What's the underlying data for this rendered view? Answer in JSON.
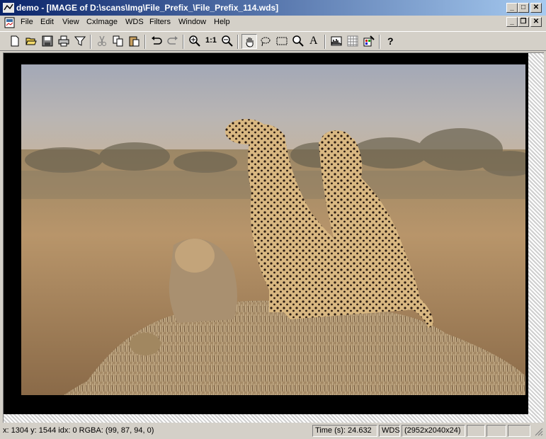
{
  "window": {
    "title": "demo - [IMAGE of D:\\scans\\Img\\File_Prefix_\\File_Prefix_114.wds]",
    "minimize": "_",
    "maximize": "□",
    "close": "✕",
    "mdi_minimize": "_",
    "mdi_restore": "❐",
    "mdi_close": "✕"
  },
  "menu": {
    "items": [
      {
        "label": "File"
      },
      {
        "label": "Edit"
      },
      {
        "label": "View"
      },
      {
        "label": "CxImage"
      },
      {
        "label": "WDS"
      },
      {
        "label": "Filters"
      },
      {
        "label": "Window"
      },
      {
        "label": "Help"
      }
    ]
  },
  "toolbar": {
    "buttons": [
      "new-icon",
      "open-icon",
      "save-icon",
      "print-icon",
      "filter-icon",
      "cut-icon",
      "copy-icon",
      "paste-icon",
      "undo-icon",
      "redo-icon",
      "zoom-in-icon",
      "actual-size-icon",
      "zoom-out-icon",
      "hand-icon",
      "lasso-icon",
      "rect-select-icon",
      "magnifier-icon",
      "text-icon",
      "histogram-icon",
      "grid-icon",
      "palette-icon",
      "help-icon"
    ],
    "actual_size_label": "1:1",
    "text_label": "A",
    "help_label": "?"
  },
  "status": {
    "coords": "x: 1304 y: 1544  idx: 0  RGBA: (99, 87, 94, 0)",
    "time": "Time (s): 24.632",
    "format": "WDS",
    "dimensions": "(2952x2040x24)"
  },
  "colors": {
    "titlebar_start": "#0a246a",
    "titlebar_end": "#a6caf0",
    "face": "#d4d0c8"
  }
}
